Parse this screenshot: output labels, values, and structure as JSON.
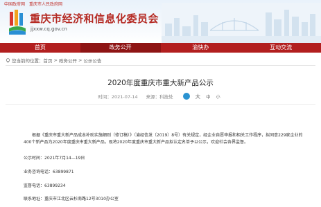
{
  "top_links": [
    "中国政府网",
    "重庆市人民政府网"
  ],
  "header": {
    "title": "重庆市经济和信息化委员会",
    "domain": "jjxxw.cq.gov.cn"
  },
  "nav": [
    {
      "label": "首页",
      "active": false
    },
    {
      "label": "政务公开",
      "active": true
    },
    {
      "label": "渝快办",
      "active": false
    },
    {
      "label": "互动交流",
      "active": false
    }
  ],
  "breadcrumb": {
    "prefix": "您当前的位置：",
    "items": [
      "首页",
      "政务公开",
      "公示公告"
    ],
    "separator": ">"
  },
  "article": {
    "title": "2020年度重庆市重大新产品公示",
    "date": "时间：2021-07-14",
    "source": "来源：科技处",
    "font_big": "大",
    "font_mid": "中",
    "font_small": "小",
    "body": "根据《重庆市重大新产品成本补助实施细则（修订稿）》（渝经信发〔2019〕8号）有关规定，经企业自愿申报和相关工作程序，拟同意229家企业的400个新产品为2020年度重庆市重大新产品，现将2020年度重庆市重大新产品拟认定名单予以公示，欢迎社会各界监督。",
    "publicity_period": "公示时间：2021年7月14—19日",
    "consult_phone": "业务咨询电话：63899871",
    "supervise_phone": "监督电话：63899234",
    "contact_address": "联系地址：重庆市江北区云杉南路12号3010办公室"
  },
  "colors": {
    "brand_red": "#b21f1f",
    "active_nav": "#8e1414",
    "title_red": "#b52a23",
    "share_blue": "#2b93d1"
  }
}
